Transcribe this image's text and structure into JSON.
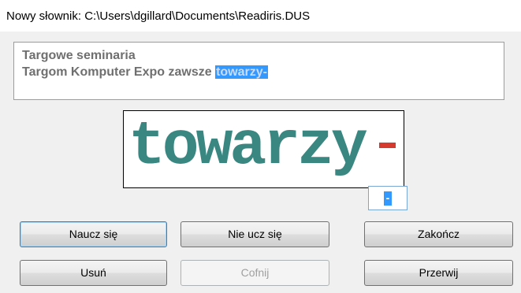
{
  "window": {
    "title": "Nowy słownik: C:\\Users\\dgillard\\Documents\\Readiris.DUS"
  },
  "context_text": {
    "line1": "Targowe seminaria",
    "line2_prefix": "Targom Komputer Expo zawsze ",
    "line2_selected": "towarzy-"
  },
  "preview": {
    "word": "towarzy",
    "hyphen_color": "#d63a2f",
    "text_color": "#3a8782"
  },
  "character_field": {
    "value": "-"
  },
  "buttons": {
    "learn": "Naucz się",
    "do_not_learn": "Nie ucz się",
    "finish": "Zakończ",
    "delete": "Usuń",
    "undo": "Cofnij",
    "abort": "Przerwij"
  },
  "colors": {
    "selection": "#3399ff"
  }
}
